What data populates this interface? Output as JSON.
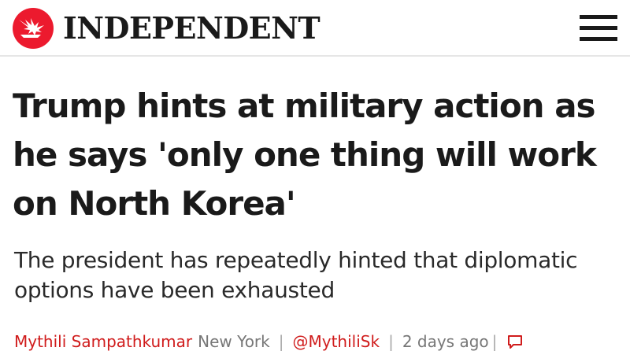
{
  "brand": {
    "wordmark": "INDEPENDENT",
    "logo_icon": "eagle-icon",
    "accent_color": "#ec1a2e"
  },
  "header": {
    "menu_icon": "hamburger-menu-icon"
  },
  "article": {
    "headline": "Trump hints at military action as he says 'only one thing will work on North Korea'",
    "standfirst": "The president has repeatedly hinted that diplomatic options have been exhausted"
  },
  "byline": {
    "author": "Mythili Sampathkumar",
    "location": "New York",
    "separator": "|",
    "twitter_handle": "@MythiliSk",
    "timestamp": "2 days ago",
    "comment_icon": "comment-icon",
    "link_color": "#d01c1c"
  }
}
